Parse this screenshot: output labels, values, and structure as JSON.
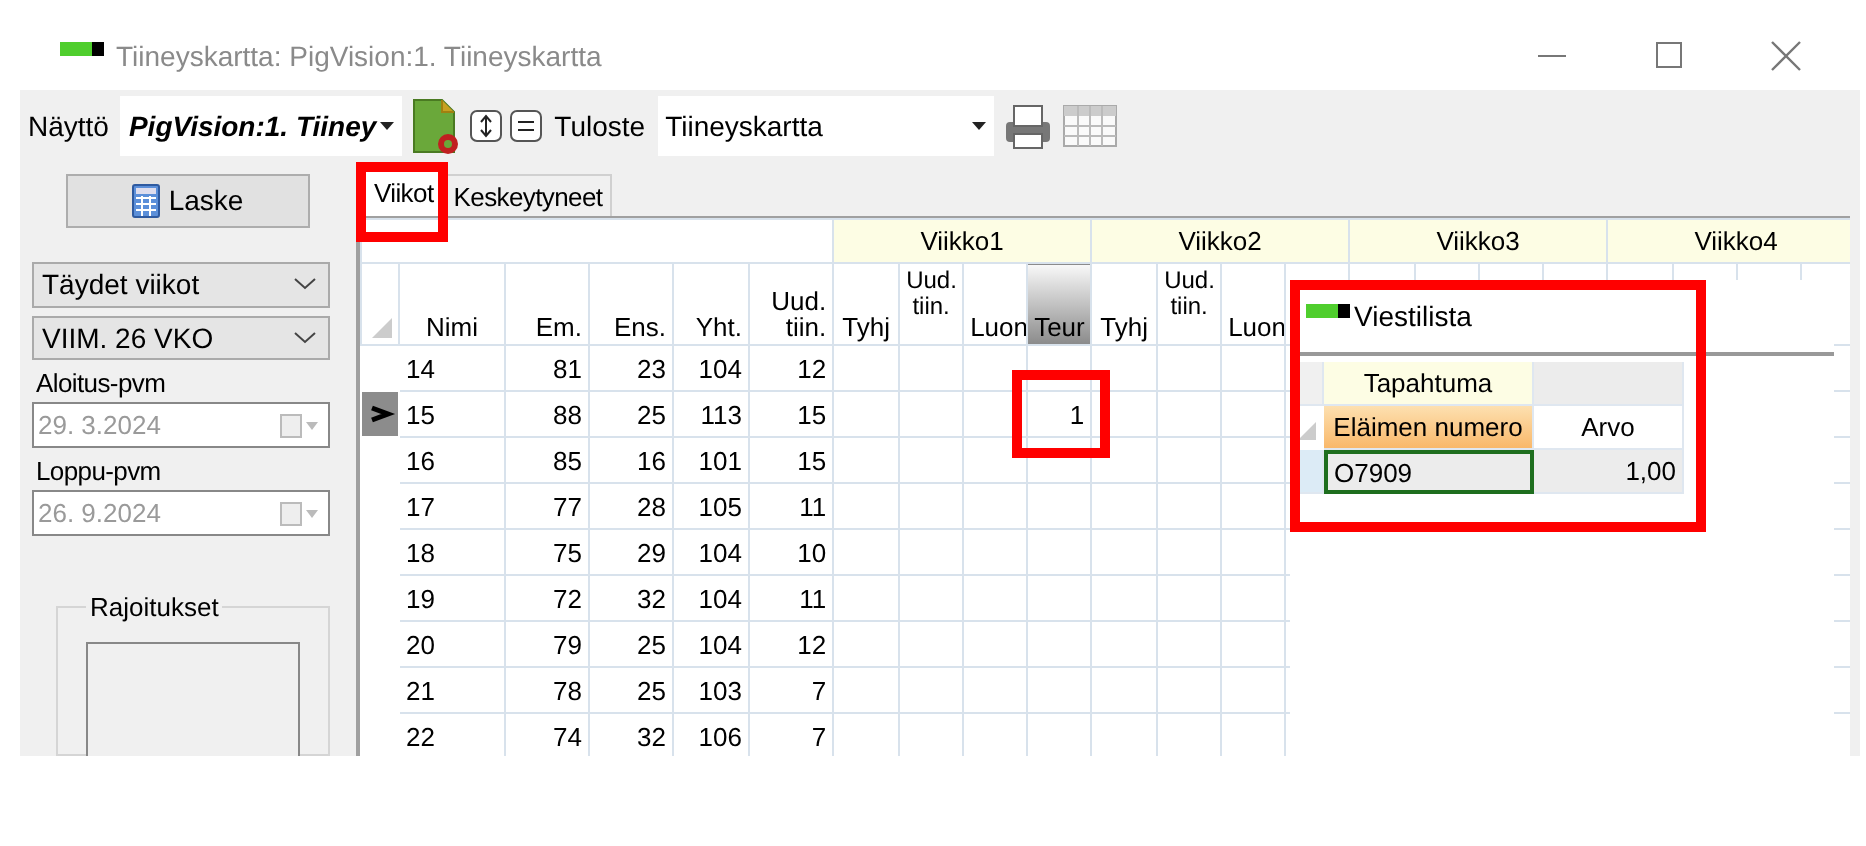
{
  "window": {
    "title": "Tiineyskartta: PigVision:1. Tiineyskartta"
  },
  "toolbar": {
    "view_label": "Näyttö",
    "view": "PigVision:1. Tiiney",
    "output_label": "Tuloste",
    "output": "Tiineyskartta"
  },
  "sidebar": {
    "button": "Laske",
    "selects": [
      "Täydet viikot",
      "VIIM. 26 VKO"
    ],
    "dates": [
      {
        "label": "Aloitus-pvm",
        "value": "29.  3.2024",
        "disabled": true
      },
      {
        "label": "Loppu-pvm",
        "value": "26.  9.2024",
        "disabled": true
      }
    ],
    "group": "Rajoitukset"
  },
  "tabs": [
    {
      "label": "Viikot",
      "selected": true,
      "highlighted": true
    },
    {
      "label": "Keskeytyneet",
      "selected": false,
      "highlighted": false
    }
  ],
  "table": {
    "columns": [
      "Nimi",
      "Em.",
      "Ens.",
      "Yht.",
      "Uud. tiin."
    ],
    "weeks": [
      {
        "label": "Viikko1",
        "columns": [
          {
            "label": "Tyhj",
            "sorted": false
          },
          {
            "label": "Uud. tiin.",
            "sorted": false
          },
          {
            "label": "Luon",
            "sorted": false
          },
          {
            "label": "Teur",
            "sorted": true
          }
        ]
      },
      {
        "label": "Viikko2",
        "columns": [
          {
            "label": "Tyhj",
            "sorted": false
          },
          {
            "label": "Uud. tiin.",
            "sorted": false
          },
          {
            "label": "Luon",
            "sorted": false
          }
        ]
      },
      {
        "label": "Viikko3"
      },
      {
        "label": "Viikko4"
      }
    ],
    "rows": [
      {
        "cells": [
          "14",
          "81",
          "23",
          "104",
          "12"
        ],
        "current": false
      },
      {
        "cells": [
          "15",
          "88",
          "25",
          "113",
          "15"
        ],
        "current": true,
        "viikko1_teur": {
          "value": "1",
          "highlighted": true
        }
      },
      {
        "cells": [
          "16",
          "85",
          "16",
          "101",
          "15"
        ],
        "current": false
      },
      {
        "cells": [
          "17",
          "77",
          "28",
          "105",
          "11"
        ],
        "current": false
      },
      {
        "cells": [
          "18",
          "75",
          "29",
          "104",
          "10"
        ],
        "current": false
      },
      {
        "cells": [
          "19",
          "72",
          "32",
          "104",
          "11"
        ],
        "current": false
      },
      {
        "cells": [
          "20",
          "79",
          "25",
          "104",
          "12"
        ],
        "current": false
      },
      {
        "cells": [
          "21",
          "78",
          "25",
          "103",
          "7"
        ],
        "current": false
      },
      {
        "cells": [
          "22",
          "74",
          "32",
          "106",
          "7"
        ],
        "current": false
      }
    ]
  },
  "message_list": {
    "title": "Viestilista",
    "highlighted": true,
    "group": "Tapahtuma",
    "columns": [
      {
        "label": "Eläimen numero",
        "sorted": true
      },
      {
        "label": "Arvo",
        "sorted": false
      }
    ],
    "rows": [
      {
        "cells": [
          "O7909",
          "1,00"
        ],
        "selected": true
      }
    ]
  }
}
